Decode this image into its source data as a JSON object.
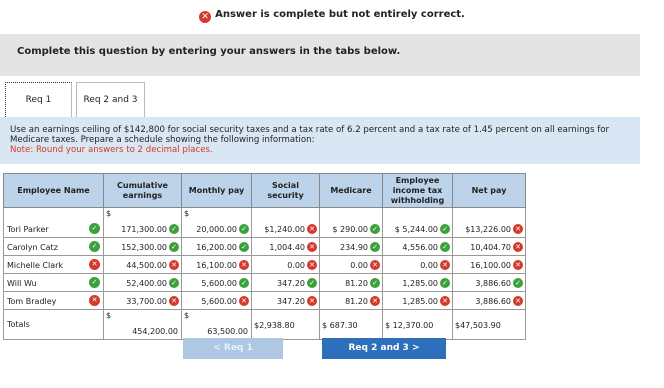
{
  "status": {
    "icon": "x-circle-icon",
    "text": "Answer is complete but not entirely correct."
  },
  "instruction": "Complete this question by entering your answers in the tabs below.",
  "tabs": [
    {
      "label": "Req 1",
      "active": true
    },
    {
      "label": "Req 2 and 3",
      "active": false
    }
  ],
  "prompt": {
    "text": "Use an earnings ceiling of $142,800 for social security taxes and a tax rate of 6.2 percent and a tax rate of 1.45 percent on all earnings for Medicare taxes. Prepare a schedule showing the following information:",
    "note": "Note: Round your answers to 2 decimal places."
  },
  "table": {
    "headers": [
      "Employee Name",
      "Cumulative earnings",
      "Monthly pay",
      "Social security",
      "Medicare",
      "Employee income tax withholding",
      "Net pay"
    ],
    "rows": [
      {
        "name": "Tori Parker",
        "name_status": "correct",
        "dollar": true,
        "cumulative": "171,300.00",
        "cumulative_status": "correct",
        "monthly": "20,000.00",
        "monthly_status": "correct",
        "ss": "$1,240.00",
        "ss_status": "incorrect",
        "medicare": "$ 290.00",
        "medicare_status": "correct",
        "tax": "$ 5,244.00",
        "tax_status": "correct",
        "net": "$13,226.00",
        "net_status": "incorrect"
      },
      {
        "name": "Carolyn Catz",
        "name_status": "correct",
        "cumulative": "152,300.00",
        "cumulative_status": "correct",
        "monthly": "16,200.00",
        "monthly_status": "correct",
        "ss": "1,004.40",
        "ss_status": "incorrect",
        "medicare": "234.90",
        "medicare_status": "correct",
        "tax": "4,556.00",
        "tax_status": "correct",
        "net": "10,404.70",
        "net_status": "incorrect"
      },
      {
        "name": "Michelle Clark",
        "name_status": "incorrect",
        "cumulative": "44,500.00",
        "cumulative_status": "incorrect",
        "monthly": "16,100.00",
        "monthly_status": "incorrect",
        "ss": "0.00",
        "ss_status": "incorrect",
        "medicare": "0.00",
        "medicare_status": "incorrect",
        "tax": "0.00",
        "tax_status": "incorrect",
        "net": "16,100.00",
        "net_status": "incorrect"
      },
      {
        "name": "Will Wu",
        "name_status": "correct",
        "cumulative": "52,400.00",
        "cumulative_status": "correct",
        "monthly": "5,600.00",
        "monthly_status": "correct",
        "ss": "347.20",
        "ss_status": "correct",
        "medicare": "81.20",
        "medicare_status": "correct",
        "tax": "1,285.00",
        "tax_status": "correct",
        "net": "3,886.60",
        "net_status": "correct"
      },
      {
        "name": "Tom Bradley",
        "name_status": "incorrect",
        "cumulative": "33,700.00",
        "cumulative_status": "incorrect",
        "monthly": "5,600.00",
        "monthly_status": "incorrect",
        "ss": "347.20",
        "ss_status": "incorrect",
        "medicare": "81.20",
        "medicare_status": "incorrect",
        "tax": "1,285.00",
        "tax_status": "incorrect",
        "net": "3,886.60",
        "net_status": "incorrect"
      }
    ],
    "totals": {
      "label": "Totals",
      "cumulative": "454,200.00",
      "monthly": "63,500.00",
      "ss": "$2,938.80",
      "medicare": "$ 687.30",
      "tax": "$ 12,370.00",
      "net": "$47,503.90"
    }
  },
  "buttons": {
    "prev": "<  Req 1",
    "next": "Req 2 and 3  >"
  }
}
